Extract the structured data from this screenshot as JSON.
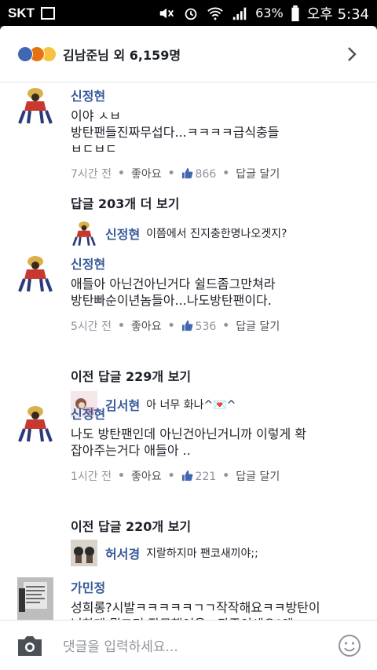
{
  "status_bar": {
    "carrier": "SKT",
    "battery_pct": "63%",
    "time": "오후 5:34"
  },
  "reactions": {
    "summary": "김남준님 외 6,159명"
  },
  "comments": [
    {
      "name": "신정현",
      "text": "이야 ㅅㅂ\n방탄팬들진짜무섭다...ㅋㅋㅋㅋ급식충들\nㅂㄷㅂㄷ",
      "time": "7시간 전",
      "like_label": "좋아요",
      "like_count": "866",
      "reply_label": "답글 달기",
      "more_replies": "답글 203개 더 보기",
      "reply": {
        "name": "신정현",
        "text": "이쯤에서 진지충한명나오겟지?"
      }
    },
    {
      "name": "신정현",
      "text": "애들아 아닌건아닌거다 쉴드좀그만쳐라\n방탄빠순이년놈들아...나도방탄팬이다.",
      "time": "5시간 전",
      "like_label": "좋아요",
      "like_count": "536",
      "reply_label": "답글 달기",
      "more_replies": "이전 답글 229개 보기",
      "reply": {
        "name": "김서현",
        "text": "아 너무 화나^💌^"
      }
    },
    {
      "name": "신정현",
      "text": "나도 방탄팬인데 아닌건아닌거니까 이렇게 확\n잡아주는거다 애들아 ..",
      "time": "1시간 전",
      "like_label": "좋아요",
      "like_count": "221",
      "reply_label": "답글 달기",
      "more_replies": "이전 답글 220개 보기",
      "reply": {
        "name": "허서경",
        "text": "지랄하지마 팬코새끼야;;"
      }
    },
    {
      "name": "가민정",
      "text": "성희롱?시발ㅋㅋㅋㅋㅋㄱㄱ작작해요ㅋㅋ방탄이\n님한테 뭘그리 잘못했어욬ㅋ관종이세요?왜\n욕먹어가면서 지랄이란 지랄은"
    }
  ],
  "composer": {
    "placeholder": "댓글을 입력하세요..."
  },
  "colors": {
    "link_name": "#365899",
    "meta_gray": "#90949c",
    "like_blue": "#4267b2"
  }
}
